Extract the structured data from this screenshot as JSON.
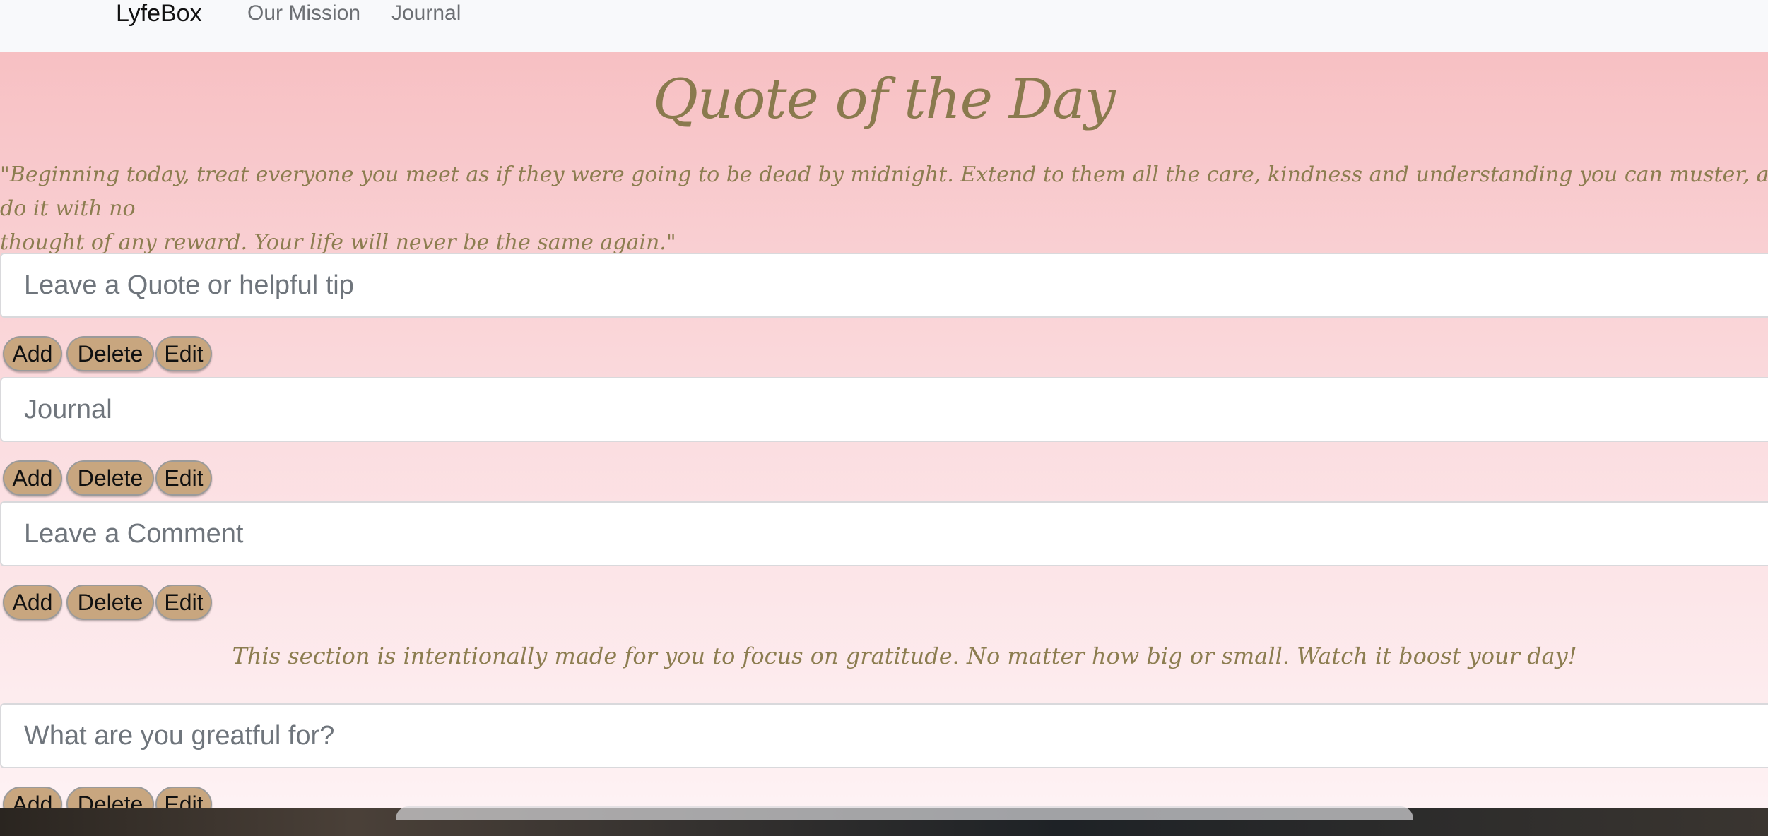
{
  "nav": {
    "brand": "LyfeBox",
    "links": [
      "Our Mission",
      "Journal"
    ]
  },
  "page": {
    "title": "Quote of the Day",
    "quote_line1": "\"Beginning today, treat everyone you meet as if they were going to be dead by midnight. Extend to them all the care, kindness and understanding you can muster, and do it with no",
    "quote_line2": "thought of any reward. Your life will never be the same again.\"",
    "gratitude_text": "This section is intentionally made for you to focus on gratitude. No matter how big or small. Watch it boost your day!"
  },
  "fields": [
    {
      "placeholder": "Leave a Quote or helpful tip",
      "value": ""
    },
    {
      "placeholder": "Journal",
      "value": ""
    },
    {
      "placeholder": "Leave a Comment",
      "value": ""
    },
    {
      "placeholder": "What are you greatful for?",
      "value": ""
    }
  ],
  "buttons": {
    "add": "Add",
    "delete": "Delete",
    "edit": "Edit"
  },
  "colors": {
    "accent_text": "#8c7d50",
    "button_bg": "#c8a67f",
    "background_top": "#f7c0c3",
    "background_bottom": "#fef2f4"
  }
}
